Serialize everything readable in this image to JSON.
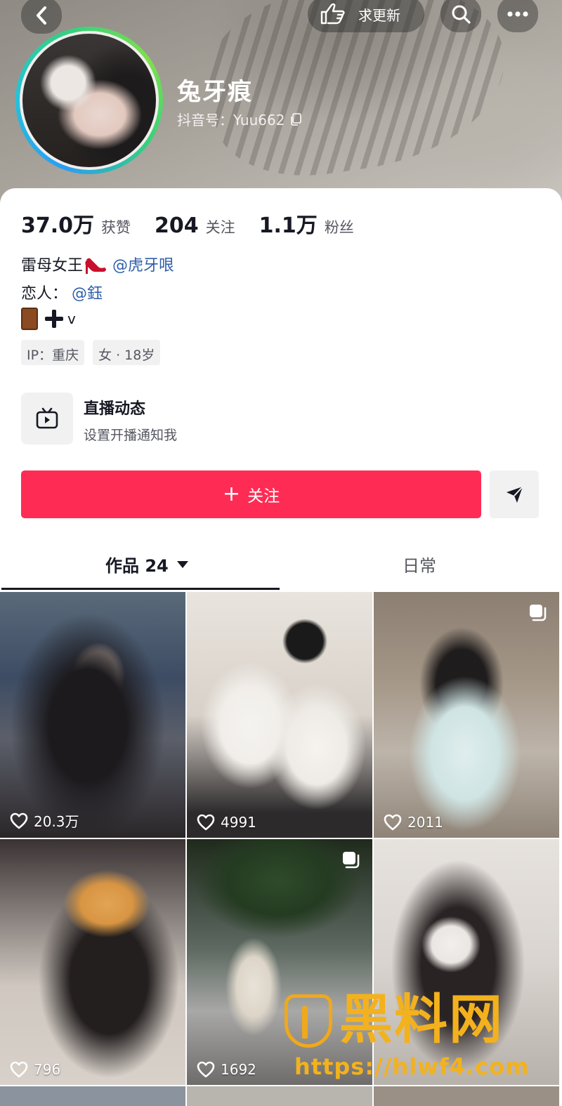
{
  "header": {
    "update_label": "求更新",
    "nickname": "兔牙痕",
    "douyin_id": "抖音号：Yuu662"
  },
  "stats": [
    {
      "value": "37.0万",
      "label": "获赞"
    },
    {
      "value": "204",
      "label": "关注"
    },
    {
      "value": "1.1万",
      "label": "粉丝"
    }
  ],
  "bio": {
    "line1_text": "雷母女王",
    "line1_mention": "@虎牙哏",
    "line2_text": "恋人：",
    "line2_mention": "@鈺",
    "line3_text": "v"
  },
  "tags": [
    "IP：重庆",
    "女 · 18岁"
  ],
  "live": {
    "title": "直播动态",
    "subtitle": "设置开播通知我"
  },
  "actions": {
    "follow_label": "关注"
  },
  "tabs": [
    {
      "label": "作品 24"
    },
    {
      "label": "日常"
    }
  ],
  "videos": [
    {
      "likes": "20.3万",
      "multi": false
    },
    {
      "likes": "4991",
      "multi": false
    },
    {
      "likes": "2011",
      "multi": true
    },
    {
      "likes": "796",
      "multi": false
    },
    {
      "likes": "1692",
      "multi": true
    },
    {
      "likes": "",
      "multi": false
    }
  ],
  "watermark": {
    "text": "黑料网",
    "url": "https://hlwf4.com"
  },
  "colors": {
    "accent": "#fe2c55",
    "mention": "#2d5fa8",
    "watermark": "#f3b21d"
  }
}
